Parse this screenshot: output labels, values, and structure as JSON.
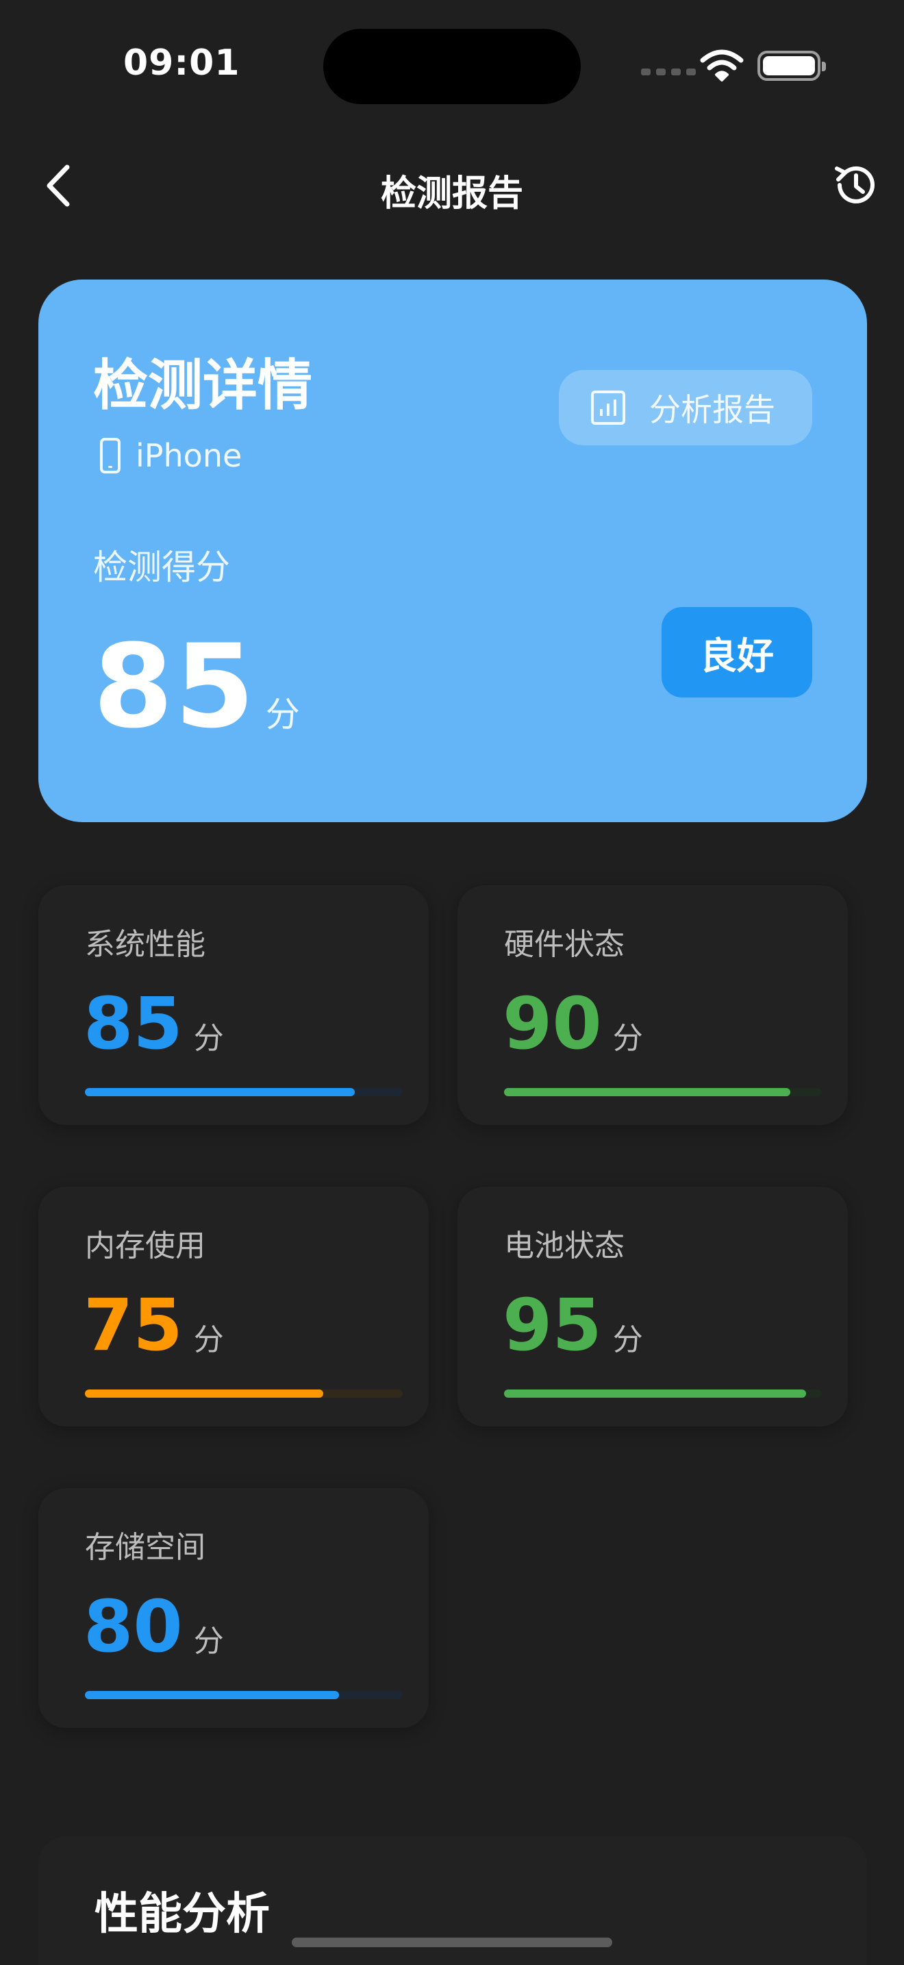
{
  "status_bar": {
    "time": "09:01"
  },
  "nav": {
    "title": "检测报告"
  },
  "hero": {
    "title": "检测详情",
    "device": "iPhone",
    "report_button": "分析报告",
    "score_label": "检测得分",
    "score": "85",
    "score_unit": "分",
    "grade": "良好",
    "background_color": "#64B5F7",
    "badge_color": "#2196F3"
  },
  "metrics": [
    {
      "label": "系统性能",
      "score": "85",
      "unit": "分",
      "progress": 0.85,
      "color": "#2196F3",
      "track_color": "#1C2733"
    },
    {
      "label": "硬件状态",
      "score": "90",
      "unit": "分",
      "progress": 0.9,
      "color": "#4CAF50",
      "track_color": "#1F2A21"
    },
    {
      "label": "内存使用",
      "score": "75",
      "unit": "分",
      "progress": 0.75,
      "color": "#FF9800",
      "track_color": "#33291B"
    },
    {
      "label": "电池状态",
      "score": "95",
      "unit": "分",
      "progress": 0.95,
      "color": "#4CAF50",
      "track_color": "#1F2A21"
    },
    {
      "label": "存储空间",
      "score": "80",
      "unit": "分",
      "progress": 0.8,
      "color": "#2196F3",
      "track_color": "#1C2733"
    }
  ],
  "performance": {
    "title": "性能分析"
  },
  "icons": {
    "back": "chevron-left-icon",
    "history": "history-icon",
    "device": "phone-icon",
    "report": "bar-chart-icon"
  }
}
